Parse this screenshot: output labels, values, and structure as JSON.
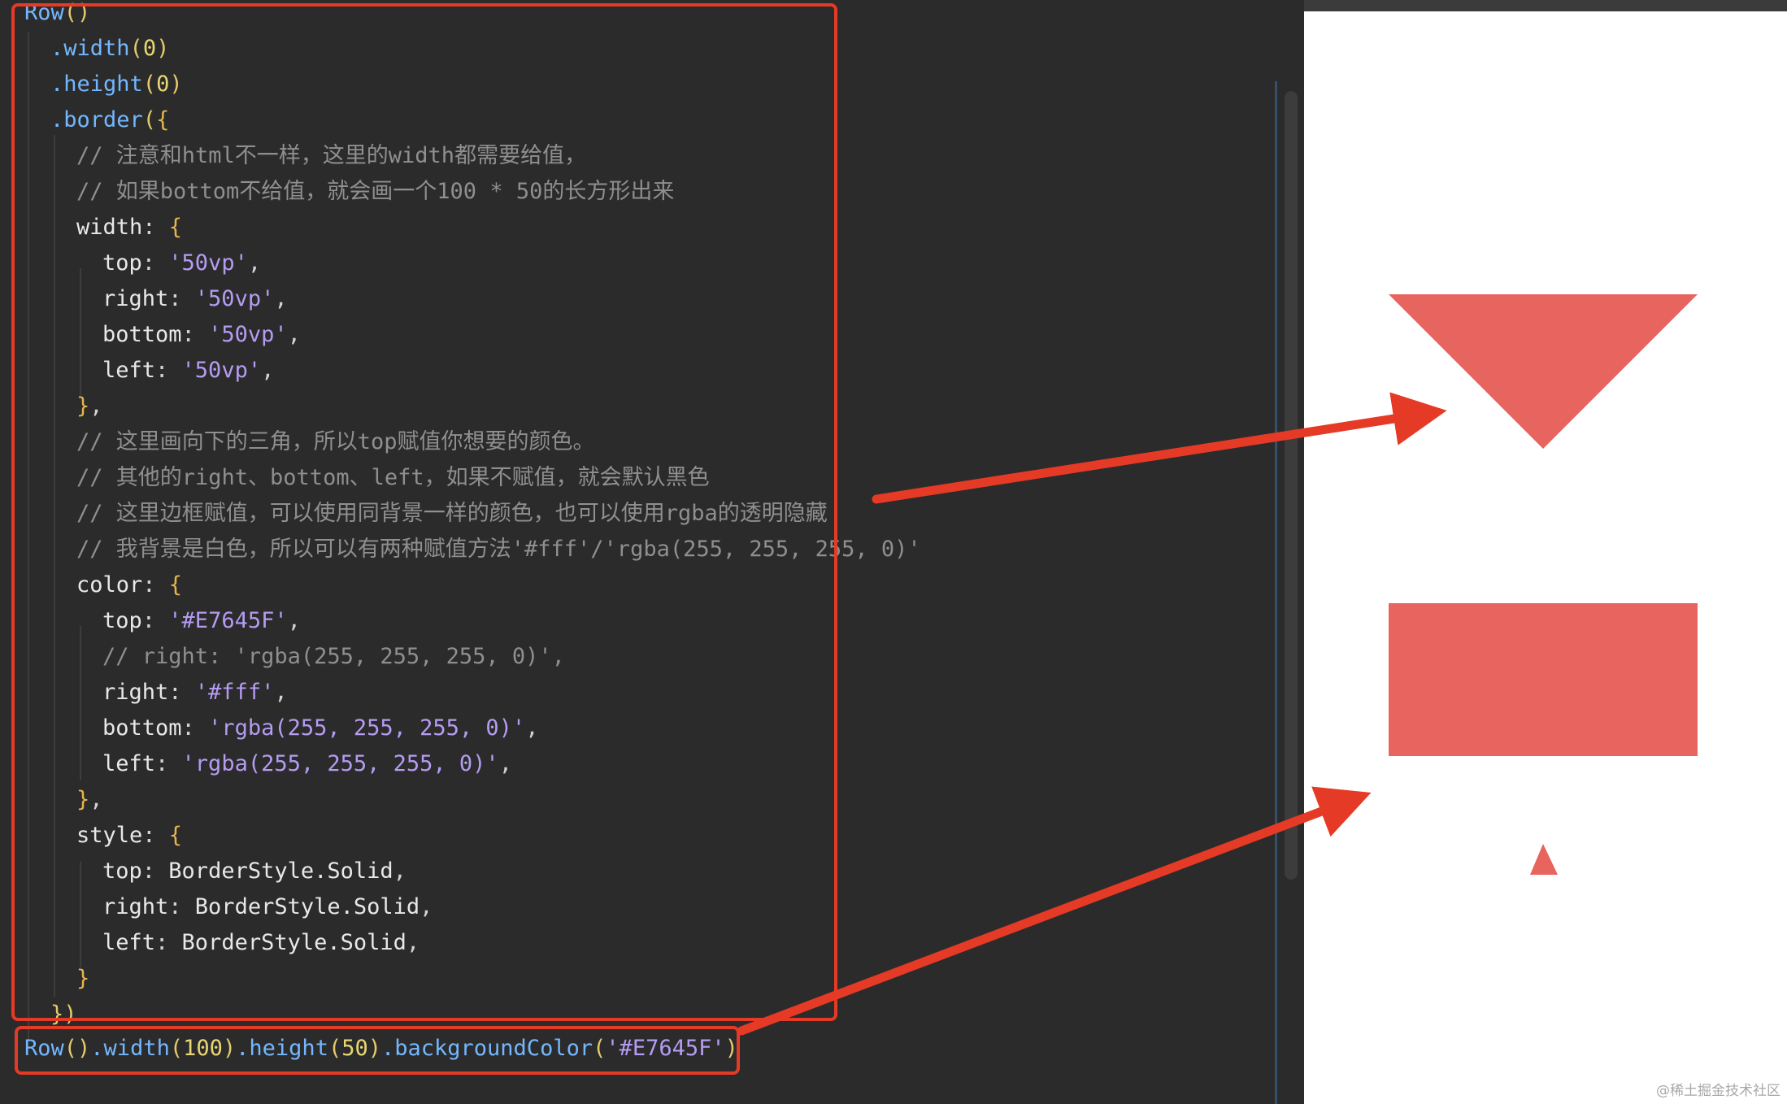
{
  "colors": {
    "shape_fill": "#E7645F",
    "annotation_red": "#e53a25",
    "editor_bg": "#2b2b2b",
    "preview_bg": "#ffffff"
  },
  "editor": {
    "lines": [
      {
        "indent": 0,
        "tokens": [
          {
            "t": "Row",
            "c": "func"
          },
          {
            "t": "()",
            "c": "paren"
          }
        ]
      },
      {
        "indent": 1,
        "tokens": [
          {
            "t": ".width",
            "c": "func"
          },
          {
            "t": "(",
            "c": "paren"
          },
          {
            "t": "0",
            "c": "num"
          },
          {
            "t": ")",
            "c": "paren"
          }
        ]
      },
      {
        "indent": 1,
        "tokens": [
          {
            "t": ".height",
            "c": "func"
          },
          {
            "t": "(",
            "c": "paren"
          },
          {
            "t": "0",
            "c": "num"
          },
          {
            "t": ")",
            "c": "paren"
          }
        ]
      },
      {
        "indent": 1,
        "tokens": [
          {
            "t": ".border",
            "c": "func"
          },
          {
            "t": "(",
            "c": "paren"
          },
          {
            "t": "{",
            "c": "brace"
          }
        ]
      },
      {
        "indent": 2,
        "tokens": [
          {
            "t": "// 注意和html不一样，这里的width都需要给值，",
            "c": "comment"
          }
        ]
      },
      {
        "indent": 2,
        "tokens": [
          {
            "t": "// 如果bottom不给值，就会画一个100 * 50的长方形出来",
            "c": "comment"
          }
        ]
      },
      {
        "indent": 2,
        "tokens": [
          {
            "t": "width",
            "c": "key"
          },
          {
            "t": ": ",
            "c": "punc"
          },
          {
            "t": "{",
            "c": "brace"
          }
        ]
      },
      {
        "indent": 3,
        "tokens": [
          {
            "t": "top",
            "c": "key"
          },
          {
            "t": ": ",
            "c": "punc"
          },
          {
            "t": "'50vp'",
            "c": "str"
          },
          {
            "t": ",",
            "c": "punc"
          }
        ]
      },
      {
        "indent": 3,
        "tokens": [
          {
            "t": "right",
            "c": "key"
          },
          {
            "t": ": ",
            "c": "punc"
          },
          {
            "t": "'50vp'",
            "c": "str"
          },
          {
            "t": ",",
            "c": "punc"
          }
        ]
      },
      {
        "indent": 3,
        "tokens": [
          {
            "t": "bottom",
            "c": "key"
          },
          {
            "t": ": ",
            "c": "punc"
          },
          {
            "t": "'50vp'",
            "c": "str"
          },
          {
            "t": ",",
            "c": "punc"
          }
        ]
      },
      {
        "indent": 3,
        "tokens": [
          {
            "t": "left",
            "c": "key"
          },
          {
            "t": ": ",
            "c": "punc"
          },
          {
            "t": "'50vp'",
            "c": "str"
          },
          {
            "t": ",",
            "c": "punc"
          }
        ]
      },
      {
        "indent": 2,
        "tokens": [
          {
            "t": "}",
            "c": "brace"
          },
          {
            "t": ",",
            "c": "punc"
          }
        ]
      },
      {
        "indent": 2,
        "tokens": [
          {
            "t": "// 这里画向下的三角，所以top赋值你想要的颜色。",
            "c": "comment"
          }
        ]
      },
      {
        "indent": 2,
        "tokens": [
          {
            "t": "// 其他的right、bottom、left，如果不赋值，就会默认黑色",
            "c": "comment"
          }
        ]
      },
      {
        "indent": 2,
        "tokens": [
          {
            "t": "// 这里边框赋值，可以使用同背景一样的颜色，也可以使用rgba的透明隐藏",
            "c": "comment"
          }
        ]
      },
      {
        "indent": 2,
        "tokens": [
          {
            "t": "// 我背景是白色，所以可以有两种赋值方法'#fff'/'rgba(255, 255, 255, 0)'",
            "c": "comment"
          }
        ]
      },
      {
        "indent": 2,
        "tokens": [
          {
            "t": "color",
            "c": "key"
          },
          {
            "t": ": ",
            "c": "punc"
          },
          {
            "t": "{",
            "c": "brace"
          }
        ]
      },
      {
        "indent": 3,
        "tokens": [
          {
            "t": "top",
            "c": "key"
          },
          {
            "t": ": ",
            "c": "punc"
          },
          {
            "t": "'#E7645F'",
            "c": "str"
          },
          {
            "t": ",",
            "c": "punc"
          }
        ]
      },
      {
        "indent": 3,
        "tokens": [
          {
            "t": "// right: 'rgba(255, 255, 255, 0)',",
            "c": "comment"
          }
        ]
      },
      {
        "indent": 3,
        "tokens": [
          {
            "t": "right",
            "c": "key"
          },
          {
            "t": ": ",
            "c": "punc"
          },
          {
            "t": "'#fff'",
            "c": "str"
          },
          {
            "t": ",",
            "c": "punc"
          }
        ]
      },
      {
        "indent": 3,
        "tokens": [
          {
            "t": "bottom",
            "c": "key"
          },
          {
            "t": ": ",
            "c": "punc"
          },
          {
            "t": "'rgba(255, 255, 255, 0)'",
            "c": "str"
          },
          {
            "t": ",",
            "c": "punc"
          }
        ]
      },
      {
        "indent": 3,
        "tokens": [
          {
            "t": "left",
            "c": "key"
          },
          {
            "t": ": ",
            "c": "punc"
          },
          {
            "t": "'rgba(255, 255, 255, 0)'",
            "c": "str"
          },
          {
            "t": ",",
            "c": "punc"
          }
        ]
      },
      {
        "indent": 2,
        "tokens": [
          {
            "t": "}",
            "c": "brace"
          },
          {
            "t": ",",
            "c": "punc"
          }
        ]
      },
      {
        "indent": 2,
        "tokens": [
          {
            "t": "style",
            "c": "key"
          },
          {
            "t": ": ",
            "c": "punc"
          },
          {
            "t": "{",
            "c": "brace"
          }
        ]
      },
      {
        "indent": 3,
        "tokens": [
          {
            "t": "top",
            "c": "key"
          },
          {
            "t": ": ",
            "c": "punc"
          },
          {
            "t": "BorderStyle.Solid",
            "c": "ident"
          },
          {
            "t": ",",
            "c": "punc"
          }
        ]
      },
      {
        "indent": 3,
        "tokens": [
          {
            "t": "right",
            "c": "key"
          },
          {
            "t": ": ",
            "c": "punc"
          },
          {
            "t": "BorderStyle.Solid",
            "c": "ident"
          },
          {
            "t": ",",
            "c": "punc"
          }
        ]
      },
      {
        "indent": 3,
        "tokens": [
          {
            "t": "left",
            "c": "key"
          },
          {
            "t": ": ",
            "c": "punc"
          },
          {
            "t": "BorderStyle.Solid",
            "c": "ident"
          },
          {
            "t": ",",
            "c": "punc"
          }
        ]
      },
      {
        "indent": 2,
        "tokens": [
          {
            "t": "}",
            "c": "brace"
          }
        ]
      },
      {
        "indent": 1,
        "tokens": [
          {
            "t": "})",
            "c": "paren"
          }
        ]
      },
      {
        "indent": 0,
        "tokens": [
          {
            "t": "Row",
            "c": "func"
          },
          {
            "t": "()",
            "c": "paren"
          },
          {
            "t": ".width",
            "c": "func"
          },
          {
            "t": "(",
            "c": "paren"
          },
          {
            "t": "100",
            "c": "num"
          },
          {
            "t": ")",
            "c": "paren"
          },
          {
            "t": ".height",
            "c": "func"
          },
          {
            "t": "(",
            "c": "paren"
          },
          {
            "t": "50",
            "c": "num"
          },
          {
            "t": ")",
            "c": "paren"
          },
          {
            "t": ".backgroundColor",
            "c": "func"
          },
          {
            "t": "(",
            "c": "paren"
          },
          {
            "t": "'#E7645F'",
            "c": "str"
          },
          {
            "t": ")",
            "c": "paren"
          }
        ]
      }
    ]
  },
  "preview": {
    "watermark": "@稀土掘金技术社区"
  }
}
